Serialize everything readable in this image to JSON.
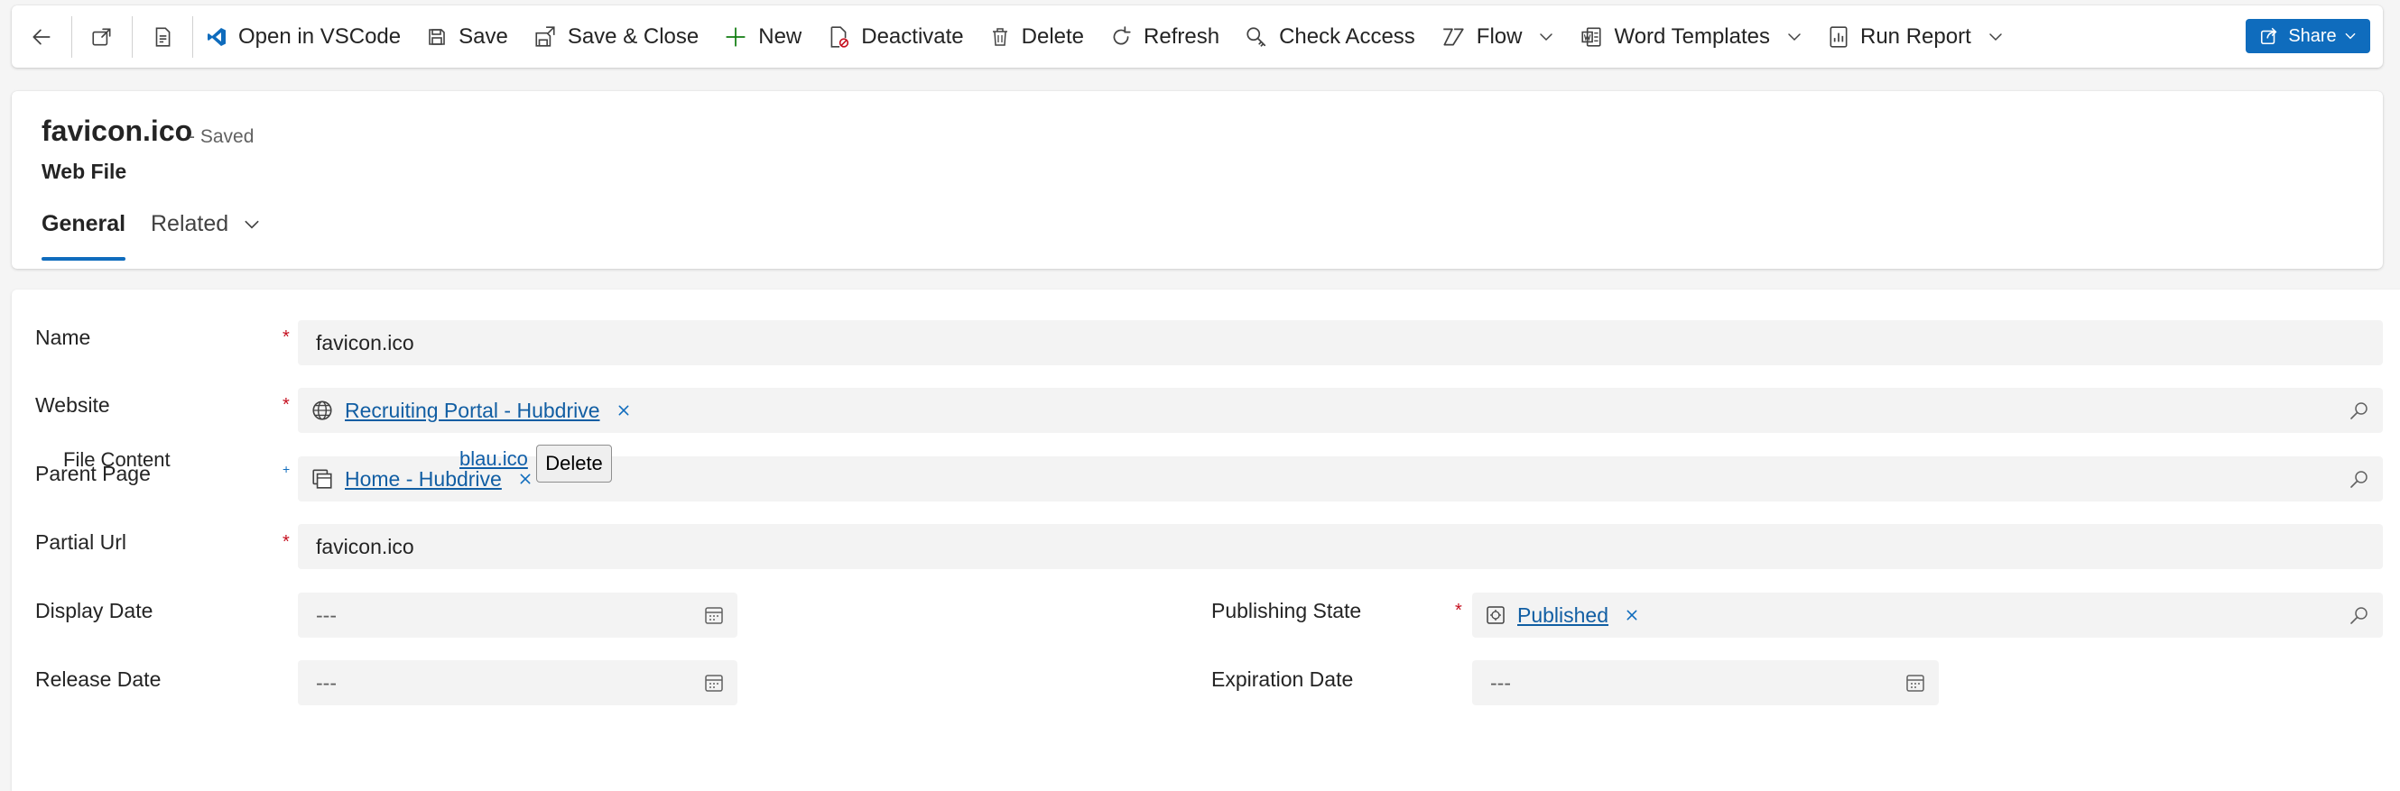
{
  "commandbar": {
    "open_vscode": "Open in VSCode",
    "save": "Save",
    "save_close": "Save & Close",
    "new": "New",
    "deactivate": "Deactivate",
    "delete": "Delete",
    "refresh": "Refresh",
    "check_access": "Check Access",
    "flow": "Flow",
    "word_templates": "Word Templates",
    "run_report": "Run Report",
    "share": "Share"
  },
  "header": {
    "title": "favicon.ico",
    "status": "- Saved",
    "entity": "Web File",
    "tabs": [
      "General",
      "Related"
    ]
  },
  "form": {
    "name": {
      "label": "Name",
      "value": "favicon.ico"
    },
    "website": {
      "label": "Website",
      "value": "Recruiting Portal - Hubdrive"
    },
    "parent_page": {
      "label": "Parent Page",
      "value": "Home - Hubdrive"
    },
    "partial_url": {
      "label": "Partial Url",
      "value": "favicon.ico"
    },
    "display_date": {
      "label": "Display Date",
      "value": "---"
    },
    "release_date": {
      "label": "Release Date",
      "value": "---"
    },
    "publishing_state": {
      "label": "Publishing State",
      "value": "Published"
    },
    "expiration_date": {
      "label": "Expiration Date",
      "value": "---"
    },
    "file_content": {
      "label": "File Content",
      "file_name": "blau.ico",
      "delete_label": "Delete"
    }
  },
  "icons": {
    "back": "back-arrow-icon",
    "popout": "open-in-new-window-icon",
    "form_switch": "form-notes-icon",
    "vscode": "vscode-icon",
    "save": "floppy-disk-icon",
    "save_close": "save-and-close-icon",
    "new": "plus-icon",
    "deactivate": "document-block-icon",
    "delete": "trash-icon",
    "refresh": "refresh-icon",
    "check_access": "key-search-icon",
    "flow": "flow-icon",
    "word_templates": "word-icon",
    "run_report": "report-icon",
    "share": "share-icon",
    "lookup_search": "search-icon",
    "calendar": "calendar-icon",
    "globe": "globe-icon",
    "webpage": "webpage-icon",
    "state": "publishing-state-icon"
  },
  "colors": {
    "accent": "#0f6cbd",
    "required": "#c50f1f",
    "link": "#115ea3",
    "field_bg": "#f3f3f3"
  }
}
